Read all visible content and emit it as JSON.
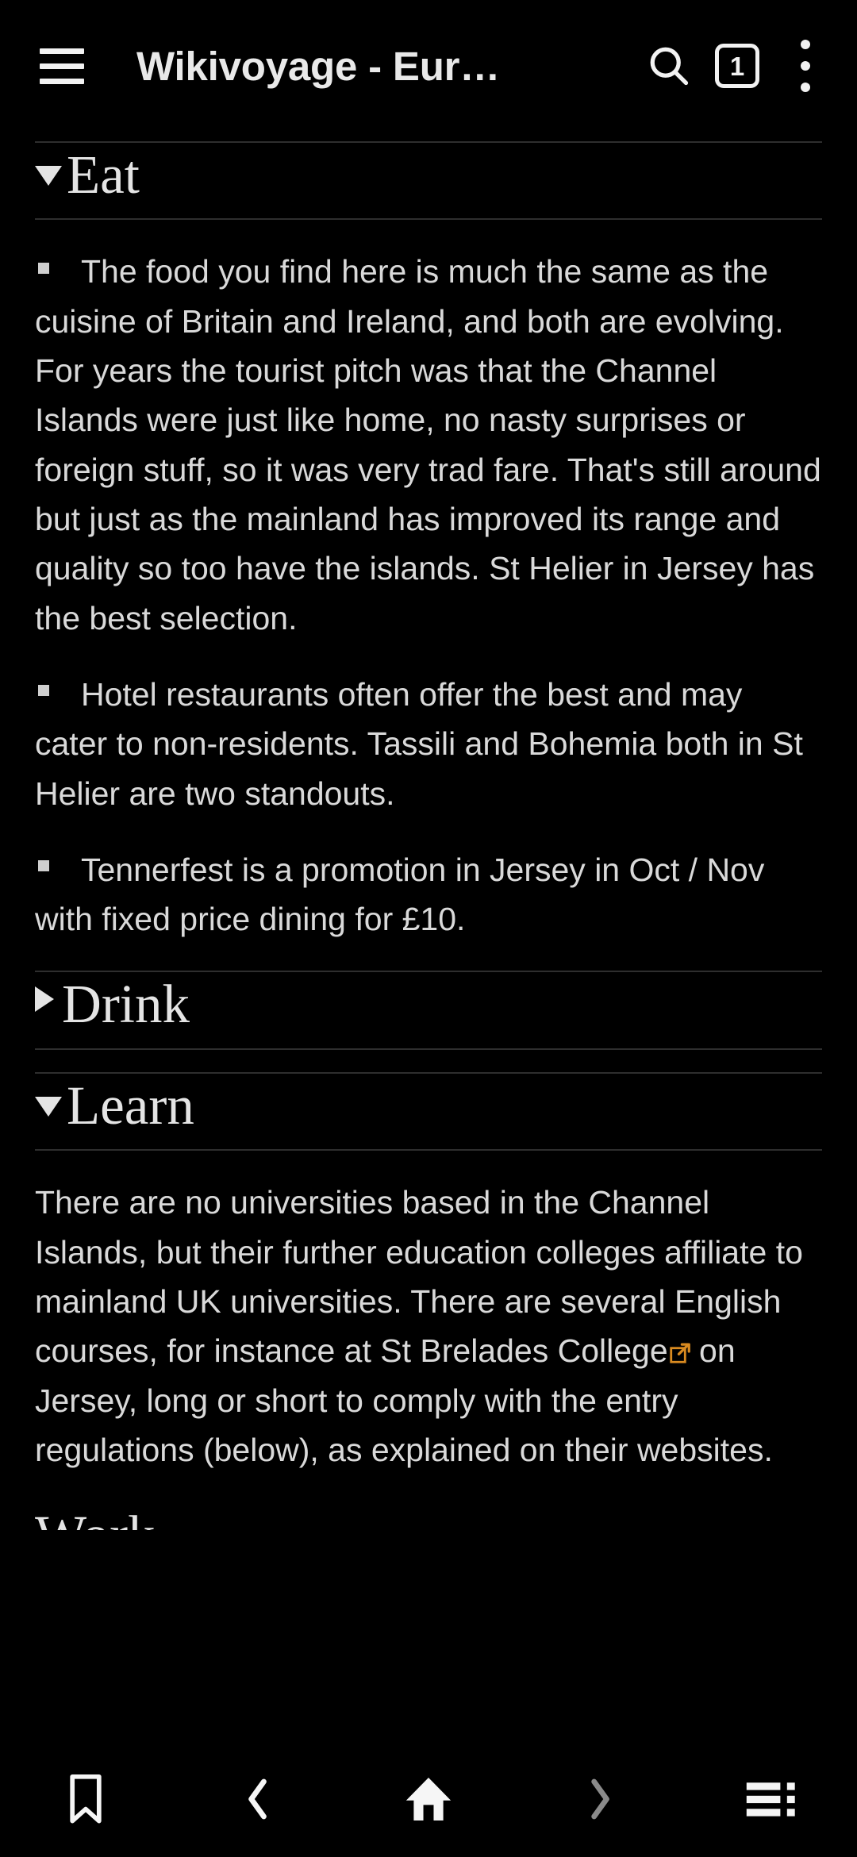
{
  "toolbar": {
    "menu_icon": "hamburger-menu-icon",
    "title": "Wikivoyage - Eur…",
    "search_icon": "search-icon",
    "tab_count": "1",
    "overflow_icon": "kebab-menu-icon"
  },
  "colors": {
    "background": "#000000",
    "text": "#d9d9d9",
    "heading": "#e4e4e4",
    "divider": "#2e2e2e",
    "external_link": "#d98a20",
    "disabled_icon": "#8a8a8a"
  },
  "sections": [
    {
      "id": "eat",
      "title": "Eat",
      "expanded": true,
      "marker": "triangle-down",
      "bullets": [
        "The food you find here is much the same as the cuisine of Britain and Ireland, and both are evolving. For years the tourist pitch was that the Channel Islands were just like home, no nasty surprises or foreign stuff, so it was very trad fare. That's still around but just as the mainland has improved its range and quality so too have the islands. St Helier in Jersey has the best selection.",
        "Hotel restaurants often offer the best and may cater to non-residents. Tassili and Bohemia both in St Helier are two standouts.",
        "Tennerfest is a promotion in Jersey in Oct / Nov with fixed price dining for £10."
      ]
    },
    {
      "id": "drink",
      "title": "Drink",
      "expanded": false,
      "marker": "triangle-right",
      "bullets": []
    },
    {
      "id": "learn",
      "title": "Learn",
      "expanded": true,
      "marker": "triangle-down",
      "paragraph": {
        "before_link": "There are no universities based in the Channel Islands, but their further education colleges affiliate to mainland UK universities. There are several English courses, for instance at St Brelades College",
        "link_icon": "external-link-icon",
        "after_link": " on Jersey, long or short to comply with the entry regulations (below), as explained on their websites."
      }
    },
    {
      "id": "work",
      "title": "Work",
      "expanded": false,
      "marker": "none",
      "clipped": true
    }
  ],
  "bottom_nav": [
    {
      "name": "bookmark-icon",
      "label": "Bookmarks",
      "enabled": true
    },
    {
      "name": "chevron-left-icon",
      "label": "Back",
      "enabled": true
    },
    {
      "name": "home-icon",
      "label": "Home",
      "enabled": true
    },
    {
      "name": "chevron-right-icon",
      "label": "Forward",
      "enabled": false
    },
    {
      "name": "list-menu-icon",
      "label": "Menu",
      "enabled": true
    }
  ]
}
